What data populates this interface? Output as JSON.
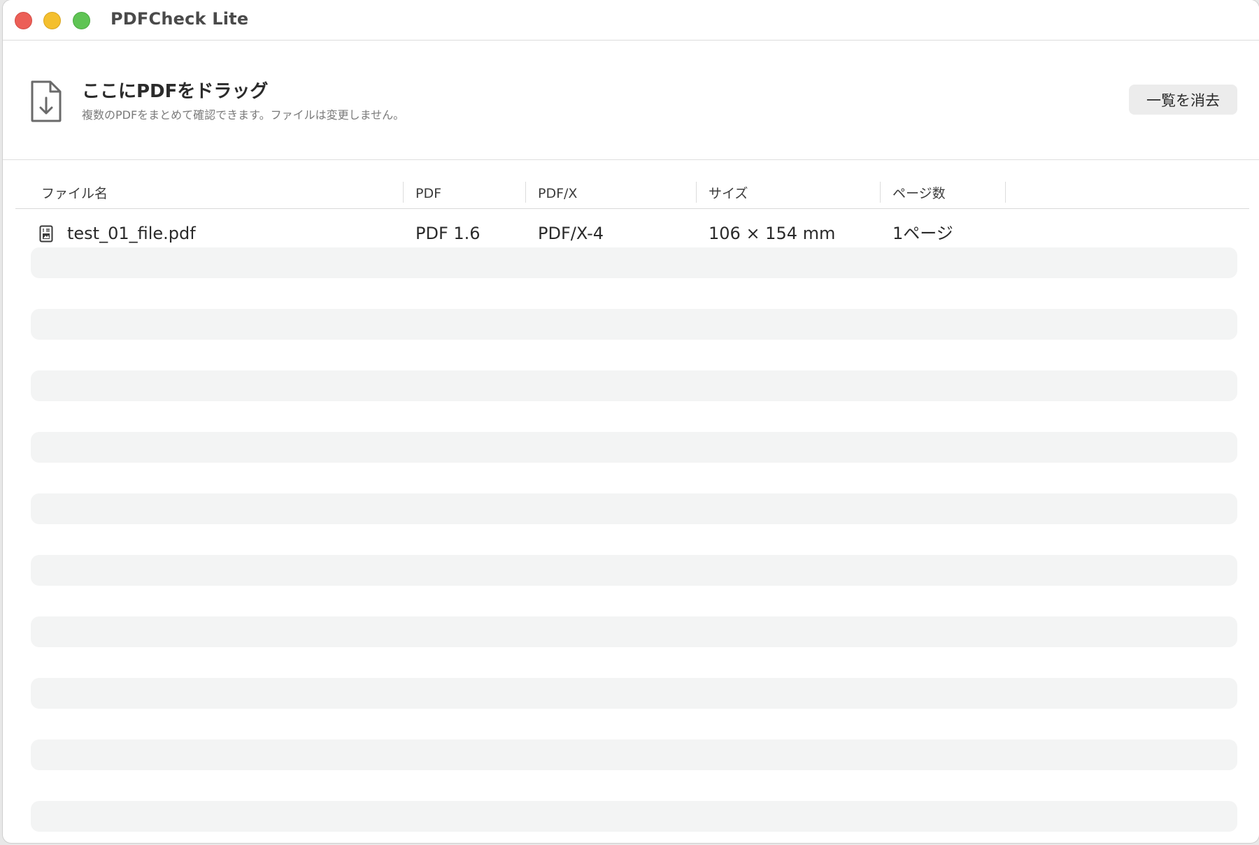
{
  "window": {
    "title": "PDFCheck Lite"
  },
  "dropzone": {
    "title": "ここにPDFをドラッグ",
    "subtitle": "複数のPDFをまとめて確認できます。ファイルは変更しません。",
    "icon": "document-download-icon"
  },
  "toolbar": {
    "clear_label": "一覧を消去"
  },
  "table": {
    "columns": [
      "ファイル名",
      "PDF",
      "PDF/X",
      "サイズ",
      "ページ数"
    ],
    "rows": [
      {
        "filename": "test_01_file.pdf",
        "pdf_version": "PDF 1.6",
        "pdfx": "PDF/X-4",
        "size": "106 × 154 mm",
        "pages": "1ページ",
        "icon": "pdf-file-icon"
      }
    ]
  },
  "colors": {
    "close": "#ec5f57",
    "minimize": "#f4bf2e",
    "maximize": "#5fc454",
    "stripe": "#f3f4f4"
  }
}
